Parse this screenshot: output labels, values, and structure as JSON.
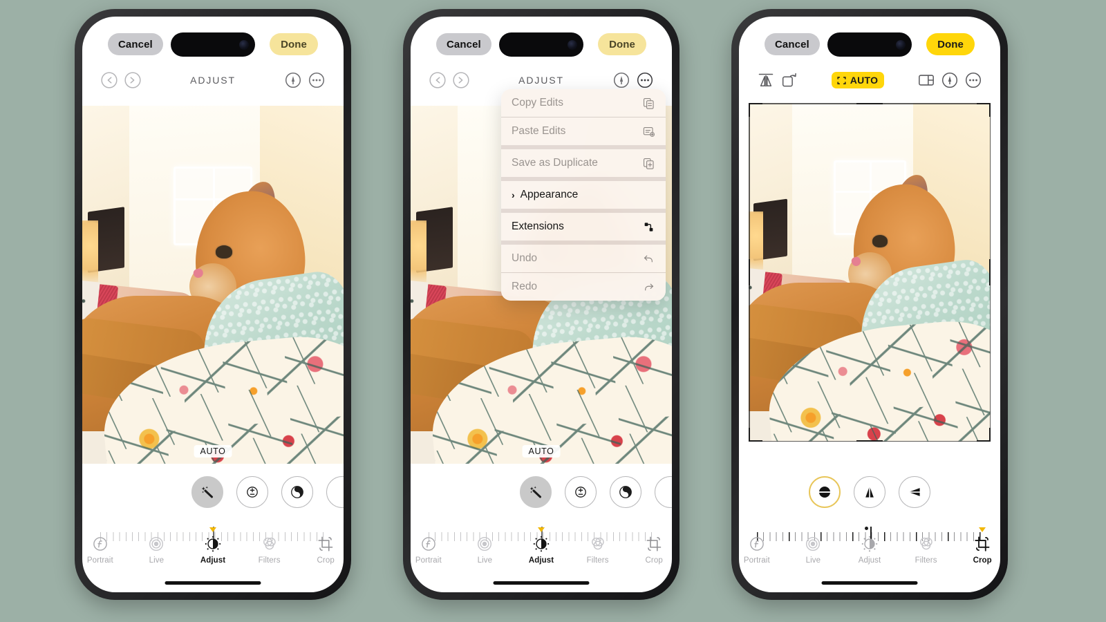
{
  "background_color": "#9cb0a6",
  "phones": [
    {
      "id": "phone-adjust",
      "topbar": {
        "cancel": "Cancel",
        "done": "Done",
        "done_style": "pale"
      },
      "toolbar": {
        "title": "ADJUST",
        "undo_icon": "undo-icon",
        "redo_icon": "redo-icon",
        "markup_icon": "markup-icon",
        "more_icon": "more-options-icon"
      },
      "photo": {
        "auto_chip": "AUTO"
      },
      "adjust_tools": [
        {
          "name": "auto-enhance",
          "icon": "magic-wand-icon",
          "selected": true
        },
        {
          "name": "exposure",
          "icon": "exposure-icon",
          "selected": false
        },
        {
          "name": "brilliance",
          "icon": "contrast-circle-icon",
          "selected": false
        },
        {
          "name": "highlights",
          "icon": "highlights-icon",
          "selected": false
        }
      ],
      "slider": {
        "value_percent": 50,
        "style": "light"
      },
      "tabs": [
        {
          "label": "Portrait",
          "icon": "portrait-f-icon",
          "active": false
        },
        {
          "label": "Live",
          "icon": "live-photo-icon",
          "active": false
        },
        {
          "label": "Adjust",
          "icon": "adjust-dial-icon",
          "active": true
        },
        {
          "label": "Filters",
          "icon": "filters-circles-icon",
          "active": false
        },
        {
          "label": "Crop",
          "icon": "crop-icon",
          "active": false
        }
      ]
    },
    {
      "id": "phone-menu",
      "topbar": {
        "cancel": "Cancel",
        "done": "Done",
        "done_style": "pale"
      },
      "toolbar": {
        "title": "ADJUST",
        "undo_icon": "undo-icon",
        "redo_icon": "redo-icon",
        "markup_icon": "markup-icon",
        "more_icon": "more-options-icon"
      },
      "photo": {
        "auto_chip": "AUTO"
      },
      "context_menu": {
        "items": [
          {
            "label": "Copy Edits",
            "icon": "copy-edits-icon",
            "enabled": false,
            "submenu": false
          },
          {
            "label": "Paste Edits",
            "icon": "paste-edits-icon",
            "enabled": false,
            "submenu": false
          },
          {
            "label": "Save as Duplicate",
            "icon": "duplicate-icon",
            "enabled": false,
            "submenu": false
          },
          {
            "label": "Appearance",
            "icon": "",
            "enabled": true,
            "submenu": true
          },
          {
            "label": "Extensions",
            "icon": "extensions-icon",
            "enabled": true,
            "submenu": false
          },
          {
            "label": "Undo",
            "icon": "undo-arrow-icon",
            "enabled": false,
            "submenu": false
          },
          {
            "label": "Redo",
            "icon": "redo-arrow-icon",
            "enabled": false,
            "submenu": false
          }
        ]
      },
      "adjust_tools": [
        {
          "name": "auto-enhance",
          "icon": "magic-wand-icon",
          "selected": true
        },
        {
          "name": "exposure",
          "icon": "exposure-icon",
          "selected": false
        },
        {
          "name": "brilliance",
          "icon": "contrast-circle-icon",
          "selected": false
        },
        {
          "name": "highlights",
          "icon": "highlights-icon",
          "selected": false
        }
      ],
      "slider": {
        "value_percent": 50,
        "style": "light"
      },
      "tabs": [
        {
          "label": "Portrait",
          "icon": "portrait-f-icon",
          "active": false
        },
        {
          "label": "Live",
          "icon": "live-photo-icon",
          "active": false
        },
        {
          "label": "Adjust",
          "icon": "adjust-dial-icon",
          "active": true
        },
        {
          "label": "Filters",
          "icon": "filters-circles-icon",
          "active": false
        },
        {
          "label": "Crop",
          "icon": "crop-icon",
          "active": false
        }
      ]
    },
    {
      "id": "phone-crop",
      "topbar": {
        "cancel": "Cancel",
        "done": "Done",
        "done_style": "bright"
      },
      "toolbar": {
        "flip_icon": "flip-horizontal-icon",
        "rotate_icon": "rotate-icon",
        "auto_label": "AUTO",
        "auto_active": true,
        "aspect_icon": "aspect-ratio-icon",
        "markup_icon": "markup-icon",
        "more_icon": "more-options-icon"
      },
      "crop_overlay": {
        "visible": true,
        "handles": [
          "tl",
          "tr",
          "bl",
          "br",
          "top",
          "bottom",
          "left",
          "right"
        ]
      },
      "crop_tools": [
        {
          "name": "straighten",
          "icon": "straighten-icon",
          "selected": true
        },
        {
          "name": "vertical-perspective",
          "icon": "vertical-perspective-icon",
          "selected": false
        },
        {
          "name": "horizontal-perspective",
          "icon": "horizontal-perspective-icon",
          "selected": false
        }
      ],
      "slider": {
        "value_percent": 49,
        "style": "dark"
      },
      "tabs": [
        {
          "label": "Portrait",
          "icon": "portrait-f-icon",
          "active": false
        },
        {
          "label": "Live",
          "icon": "live-photo-icon",
          "active": false
        },
        {
          "label": "Adjust",
          "icon": "adjust-dial-icon",
          "active": false
        },
        {
          "label": "Filters",
          "icon": "filters-circles-icon",
          "active": false
        },
        {
          "label": "Crop",
          "icon": "crop-icon",
          "active": true
        }
      ]
    }
  ],
  "colors": {
    "accent_yellow": "#ffd60a",
    "pale_yellow": "#f6e49b",
    "cancel_grey": "#c9c9cd",
    "tab_inactive": "#a8a8ac",
    "tab_active": "#141414",
    "menu_bg": "#f7eee8"
  }
}
